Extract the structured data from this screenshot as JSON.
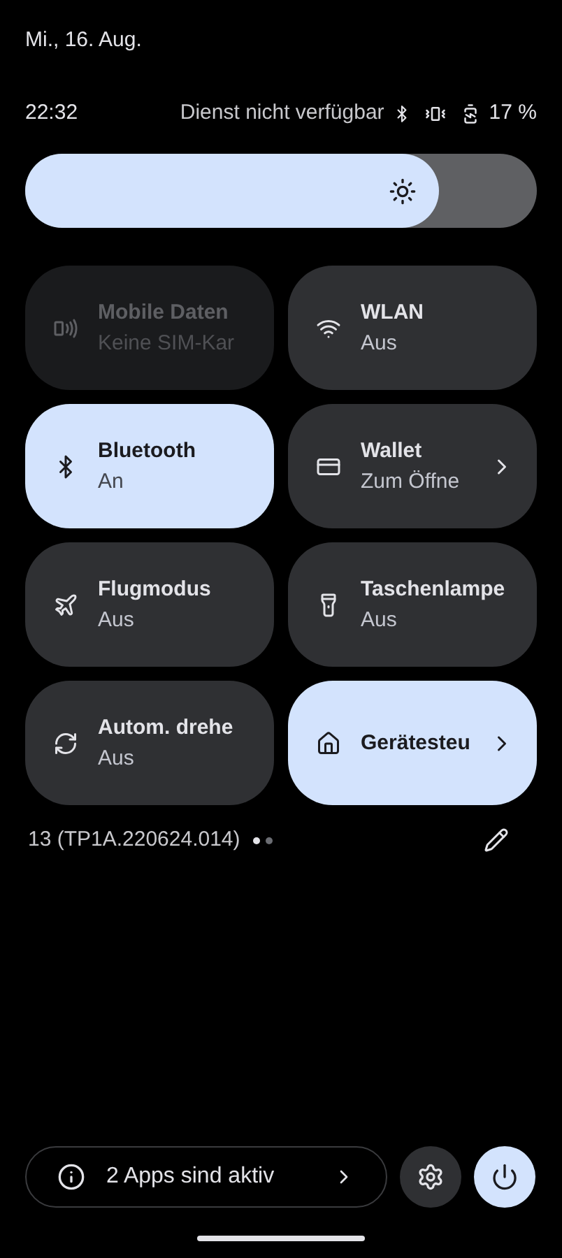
{
  "header": {
    "date": "Mi., 16. Aug."
  },
  "status_bar": {
    "time": "22:32",
    "carrier": "Dienst nicht verfügbar",
    "battery": "17 %"
  },
  "brightness": {
    "level": 0.81
  },
  "tiles": [
    {
      "title": "Mobile Daten",
      "subtitle": "Keine SIM-Kar",
      "disabled": true,
      "chevron": false
    },
    {
      "title": "WLAN",
      "subtitle": "Aus",
      "on": false,
      "disabled": false,
      "chevron": false
    },
    {
      "title": "Bluetooth",
      "subtitle": "An",
      "on": true,
      "disabled": false,
      "chevron": false
    },
    {
      "title": "Wallet",
      "subtitle": "Zum Öffne",
      "on": false,
      "disabled": false,
      "chevron": true
    },
    {
      "title": "Flugmodus",
      "subtitle": "Aus",
      "on": false,
      "disabled": false,
      "chevron": false
    },
    {
      "title": "Taschenlampe",
      "subtitle": "Aus",
      "on": false,
      "disabled": false,
      "chevron": false
    },
    {
      "title": "Autom. drehe",
      "subtitle": "Aus",
      "on": false,
      "disabled": false,
      "chevron": false
    },
    {
      "title": "Gerätesteu",
      "on": true,
      "disabled": false,
      "chevron": true
    }
  ],
  "footer": {
    "build": "13 (TP1A.220624.014)",
    "pages": [
      {
        "selected": true
      },
      {
        "selected": false
      }
    ]
  },
  "bottom": {
    "active_apps": "2 Apps sind aktiv"
  }
}
